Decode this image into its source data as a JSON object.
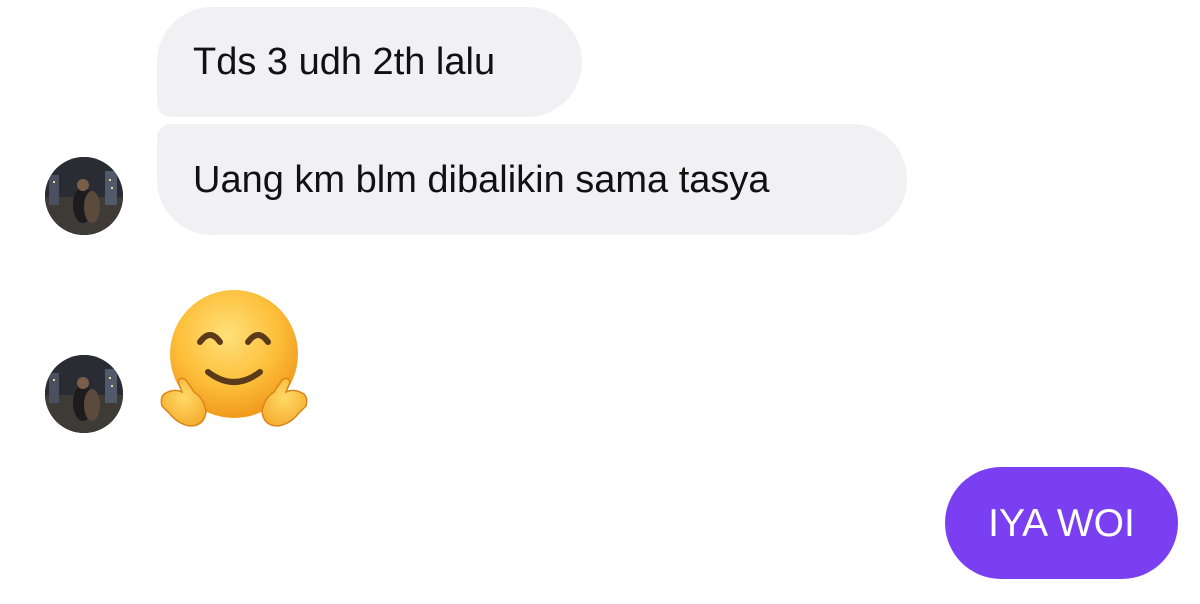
{
  "conversation": {
    "messages": [
      {
        "sender": "other",
        "type": "text",
        "text": "Tds 3 udh 2th lalu"
      },
      {
        "sender": "other",
        "type": "text",
        "text": "Uang km blm dibalikin sama tasya"
      },
      {
        "sender": "other",
        "type": "emoji",
        "emoji": "hugging-face-emoji"
      },
      {
        "sender": "self",
        "type": "text",
        "text": "IYA WOI"
      }
    ]
  },
  "colors": {
    "incoming_bubble": "#f1f1f4",
    "outgoing_bubble": "#7b3ff2",
    "incoming_text": "#111111",
    "outgoing_text": "#ffffff"
  }
}
